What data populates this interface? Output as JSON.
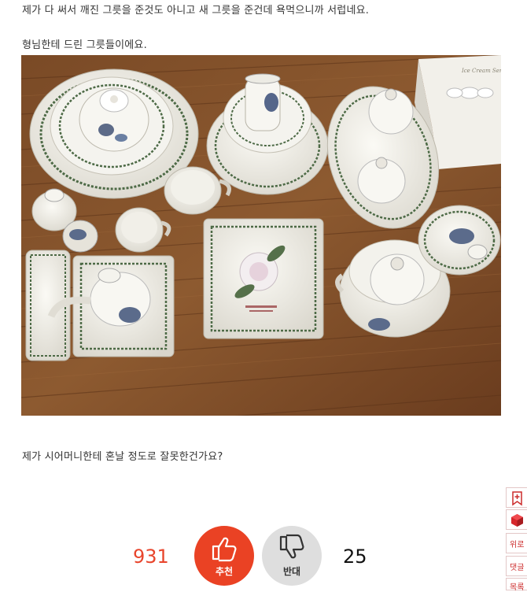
{
  "post": {
    "line1": "제가 다 써서 깨진 그릇을 준것도 아니고 새 그릇을 준건데 욕먹으니까 서럽네요.",
    "line2": "형님한테 드린 그릇들이에요.",
    "line3": "제가 시어머니한테 혼날 정도로 잘못한건가요?"
  },
  "photo": {
    "box_lid_text": "Ice Cream Server"
  },
  "vote": {
    "up_count": "931",
    "up_label": "추천",
    "down_count": "25",
    "down_label": "반대",
    "up_color": "#ea4224",
    "down_color": "#dedede"
  },
  "side_menu": {
    "bookmark_icon": "bookmark-plus-icon",
    "cube_icon": "red-cube-icon",
    "up_label": "위로",
    "comment_label": "댓글",
    "list_label": "목록"
  }
}
